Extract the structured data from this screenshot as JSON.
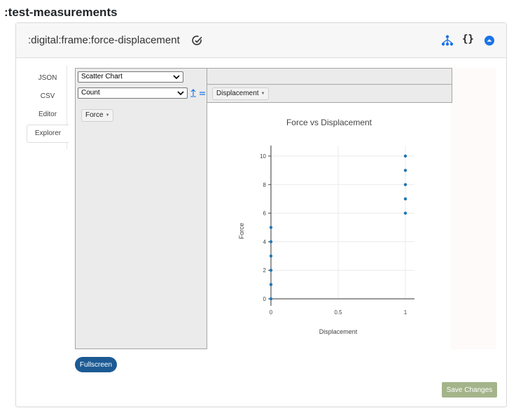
{
  "page": {
    "title": ":test-measurements"
  },
  "frame": {
    "name": ":digital:frame:force-displacement",
    "icons": {
      "edit": "edit-check-icon",
      "hierarchy": "hierarchy-icon",
      "json": "braces-icon",
      "collapse": "collapse-up-icon"
    },
    "braces_text": "{}"
  },
  "tabs": [
    {
      "label": "JSON",
      "active": false
    },
    {
      "label": "CSV",
      "active": false
    },
    {
      "label": "Editor",
      "active": false
    },
    {
      "label": "Explorer",
      "active": true
    }
  ],
  "explorer": {
    "renderer": "Scatter Chart",
    "aggregator": "Count",
    "col_field": "Displacement",
    "row_field": "Force",
    "fullscreen_label": "Fullscreen"
  },
  "chart_data": {
    "type": "scatter",
    "title": "Force vs Displacement",
    "xlabel": "Displacement",
    "ylabel": "Force",
    "xlim": [
      0,
      1
    ],
    "ylim": [
      0,
      10
    ],
    "x_ticks": [
      "0",
      "0.5",
      "1"
    ],
    "y_ticks": [
      "0",
      "2",
      "4",
      "6",
      "8",
      "10"
    ],
    "grid": true,
    "color": "#1f77b4",
    "points": [
      {
        "x": 0,
        "y": 0
      },
      {
        "x": 0,
        "y": 1
      },
      {
        "x": 0,
        "y": 2
      },
      {
        "x": 0,
        "y": 3
      },
      {
        "x": 0,
        "y": 4
      },
      {
        "x": 0,
        "y": 5
      },
      {
        "x": 1,
        "y": 6
      },
      {
        "x": 1,
        "y": 7
      },
      {
        "x": 1,
        "y": 8
      },
      {
        "x": 1,
        "y": 9
      },
      {
        "x": 1,
        "y": 10
      }
    ]
  },
  "footer": {
    "save_label": "Save Changes"
  },
  "colors": {
    "primary": "#1c5a94",
    "save": "#a4b48a",
    "icon_blue": "#1a73e8"
  }
}
